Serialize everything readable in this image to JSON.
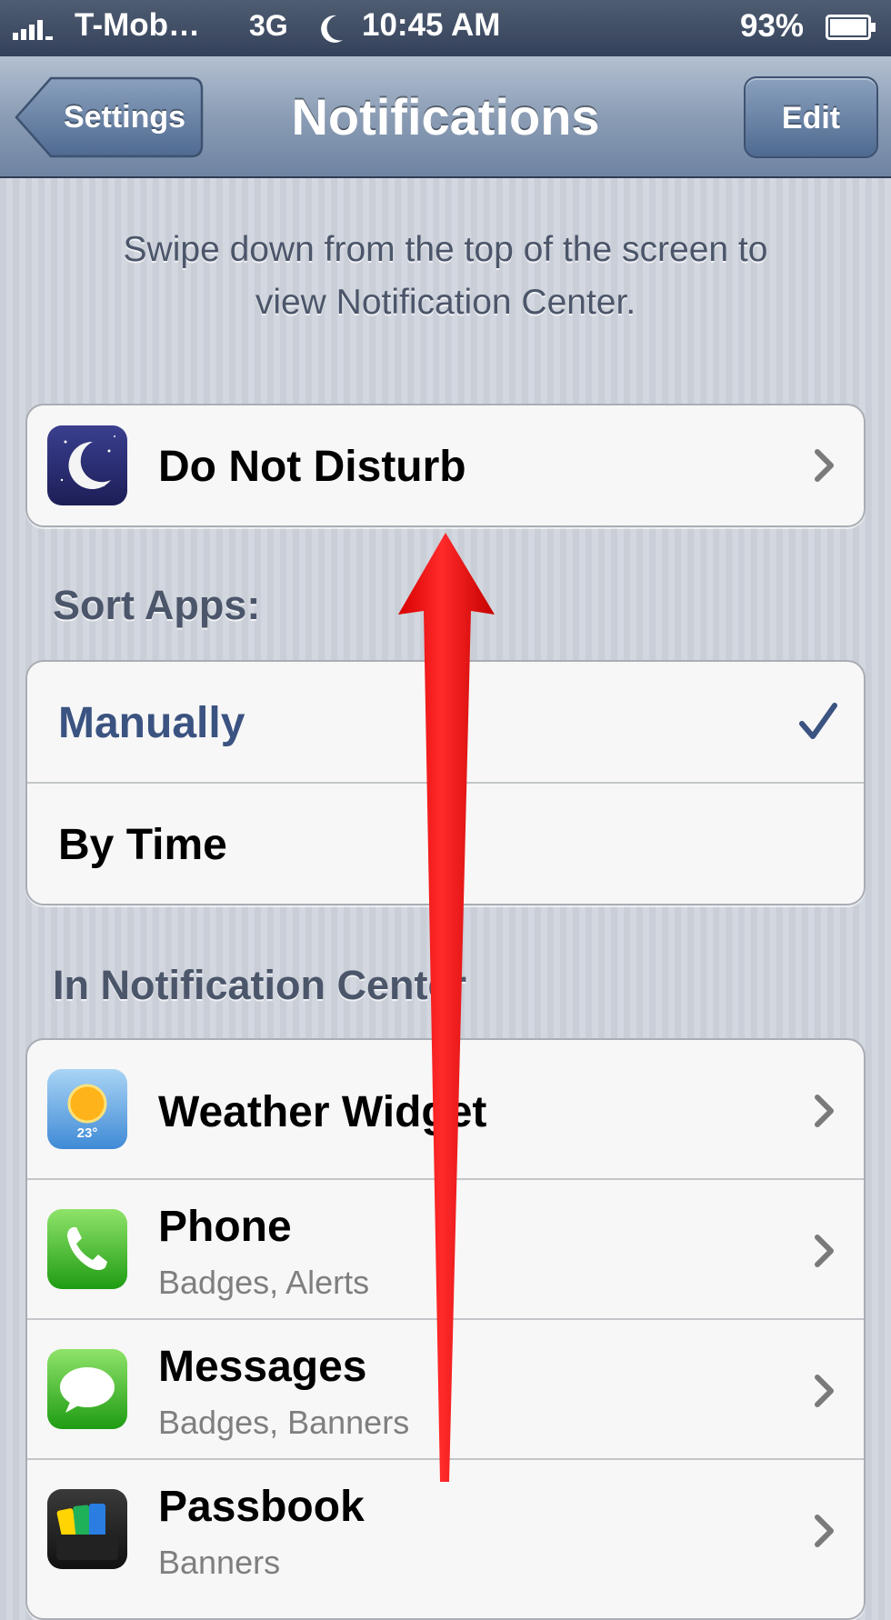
{
  "status_bar": {
    "carrier": "T-Mob…",
    "network": "3G",
    "time": "10:45 AM",
    "battery": "93%",
    "signal_icon": "signal-bars-icon",
    "moon_icon": "do-not-disturb-moon-icon",
    "battery_icon": "battery-icon"
  },
  "nav": {
    "back_label": "Settings",
    "title": "Notifications",
    "edit_label": "Edit"
  },
  "info_text_line1": "Swipe down from the top of the screen to",
  "info_text_line2": "view Notification Center.",
  "dnd": {
    "label": "Do Not Disturb",
    "icon": "moon-icon"
  },
  "sort_apps": {
    "header": "Sort Apps:",
    "options": [
      {
        "label": "Manually",
        "selected": true
      },
      {
        "label": "By Time",
        "selected": false
      }
    ]
  },
  "in_notification_center": {
    "header": "In Notification Center",
    "apps": [
      {
        "name": "Weather Widget",
        "subtitle": "",
        "icon": "weather-icon",
        "icon_text": "23°"
      },
      {
        "name": "Phone",
        "subtitle": "Badges, Alerts",
        "icon": "phone-icon"
      },
      {
        "name": "Messages",
        "subtitle": "Badges, Banners",
        "icon": "messages-icon"
      },
      {
        "name": "Passbook",
        "subtitle": "Banners",
        "icon": "passbook-icon"
      }
    ]
  },
  "colors": {
    "selected_text": "#3b5381",
    "annotation_arrow": "#ff1a1a"
  }
}
